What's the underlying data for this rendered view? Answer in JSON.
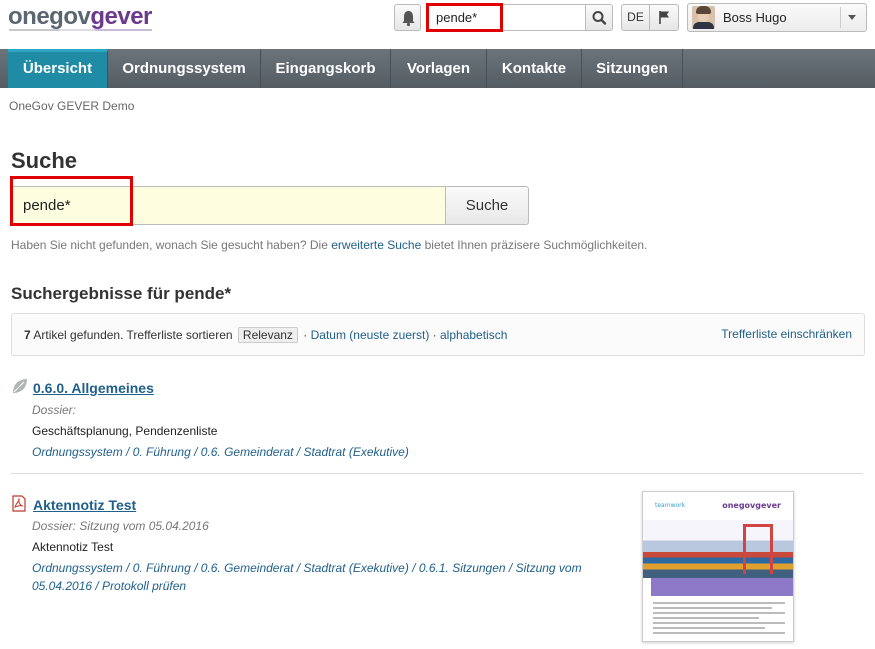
{
  "logo": {
    "part1": "one",
    "part2": "gov",
    "part3": "gever"
  },
  "header": {
    "search_value": "pende*",
    "lang": "DE",
    "user_name": "Boss Hugo"
  },
  "nav": {
    "items": [
      {
        "label": "Übersicht",
        "active": true
      },
      {
        "label": "Ordnungssystem"
      },
      {
        "label": "Eingangskorb"
      },
      {
        "label": "Vorlagen"
      },
      {
        "label": "Kontakte"
      },
      {
        "label": "Sitzungen"
      }
    ]
  },
  "breadcrumb": "OneGov GEVER Demo",
  "page": {
    "title": "Suche",
    "search_value": "pende*",
    "search_button": "Suche",
    "hint_before": "Haben Sie nicht gefunden, wonach Sie gesucht haben? Die ",
    "hint_link": "erweiterte Suche",
    "hint_after": " bietet Ihnen präzisere Suchmöglichkeiten."
  },
  "results": {
    "title": "Suchergebnisse für pende*",
    "count": "7",
    "count_text": " Artikel gefunden. Trefferliste sortieren ",
    "sort_active": "Relevanz",
    "sep": " · ",
    "sort_date": "Datum (neuste zuerst)",
    "sort_alpha": "alphabetisch",
    "filter_link": "Trefferliste einschränken",
    "items": [
      {
        "title": "0.6.0. Allgemeines",
        "type": "Dossier:",
        "description": "Geschäftsplanung, Pendenzenliste",
        "path": "Ordnungssystem / 0. Führung / 0.6. Gemeinderat / Stadtrat (Exekutive)",
        "icon": "leaf-icon"
      },
      {
        "title": "Aktennotiz Test",
        "type": "Dossier: Sitzung vom 05.04.2016",
        "description": "Aktennotiz Test",
        "path_line1": "Ordnungssystem / 0. Führung / 0.6. Gemeinderat / Stadtrat (Exekutive) / 0.6.1. Sitzungen / Sitzung vom",
        "path_line2": "05.04.2016 / Protokoll prüfen",
        "icon": "pdf-icon",
        "preview": {
          "logo_left": "teamwork",
          "logo_right": "onegovgever"
        }
      }
    ]
  },
  "colors": {
    "nav_active": "#1f8ba4",
    "link": "#1f5f8b",
    "highlight": "#e00000",
    "search_bg": "#fdfde0"
  }
}
